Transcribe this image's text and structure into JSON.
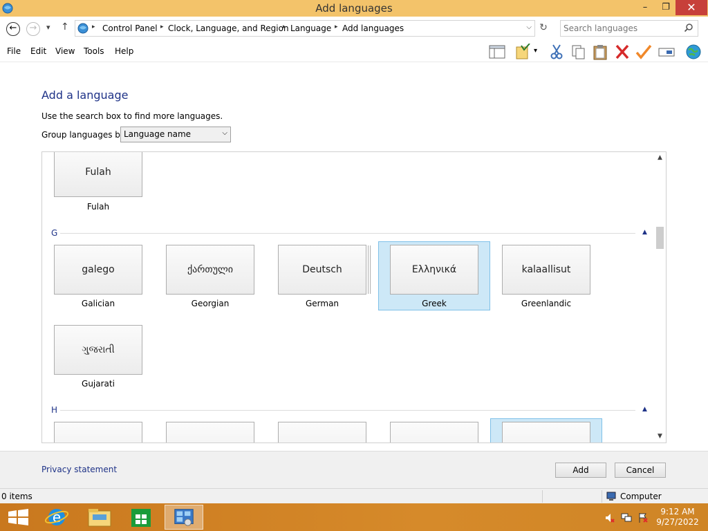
{
  "window": {
    "title": "Add languages"
  },
  "address": {
    "breadcrumbs": [
      "Control Panel",
      "Clock, Language, and Region",
      "Language",
      "Add languages"
    ],
    "search_placeholder": "Search languages"
  },
  "menu": {
    "items": [
      "File",
      "Edit",
      "View",
      "Tools",
      "Help"
    ]
  },
  "page": {
    "heading": "Add a language",
    "hint": "Use the search box to find more languages.",
    "group_by_label": "Group languages by:",
    "group_by_value": "Language name"
  },
  "sections": {
    "g_letter": "G",
    "h_letter": "H"
  },
  "languages": {
    "fulah": {
      "native": "Fulah",
      "name": "Fulah"
    },
    "galician": {
      "native": "galego",
      "name": "Galician"
    },
    "georgian": {
      "native": "ქართული",
      "name": "Georgian"
    },
    "german": {
      "native": "Deutsch",
      "name": "German"
    },
    "greek": {
      "native": "Ελληνικά",
      "name": "Greek"
    },
    "greenlandic": {
      "native": "kalaallisut",
      "name": "Greenlandic"
    },
    "gujarati": {
      "native": "ગુજરાતી",
      "name": "Gujarati"
    }
  },
  "footer": {
    "privacy": "Privacy statement",
    "add": "Add",
    "cancel": "Cancel"
  },
  "status": {
    "items": "0 items",
    "location": "Computer"
  },
  "clock": {
    "time": "9:12 AM",
    "date": "9/27/2022"
  },
  "colors": {
    "titlebar": "#f3c36a",
    "link": "#1e3287",
    "selection": "#cde8f7",
    "taskbar": "#d68a2a"
  }
}
